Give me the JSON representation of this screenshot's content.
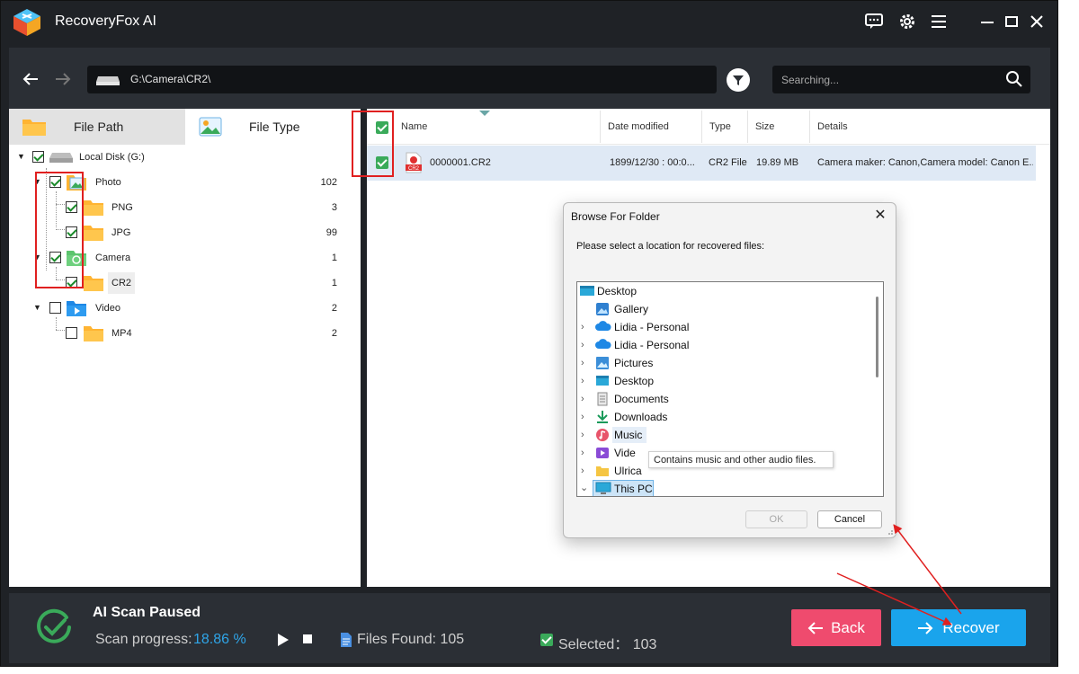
{
  "app": {
    "title": "RecoveryFox AI"
  },
  "navbar": {
    "path": "G:\\Camera\\CR2\\",
    "search_placeholder": "Searching..."
  },
  "left_panel": {
    "tabs": [
      {
        "label": "File Path"
      },
      {
        "label": "File Type"
      }
    ],
    "tree": {
      "root": {
        "label": "Local Disk (G:)",
        "checked": true
      },
      "items": [
        {
          "label": "Photo",
          "count": "102",
          "checked": true
        },
        {
          "label": "PNG",
          "count": "3",
          "checked": true
        },
        {
          "label": "JPG",
          "count": "99",
          "checked": true
        },
        {
          "label": "Camera",
          "count": "1",
          "checked": true
        },
        {
          "label": "CR2",
          "count": "1",
          "checked": true
        },
        {
          "label": "Video",
          "count": "2",
          "checked": false
        },
        {
          "label": "MP4",
          "count": "2",
          "checked": false
        }
      ]
    }
  },
  "file_table": {
    "columns": [
      "Name",
      "Date modified",
      "Type",
      "Size",
      "Details"
    ],
    "rows": [
      {
        "name": "0000001.CR2",
        "date": "1899/12/30 : 00:0...",
        "type": "CR2 File",
        "size": "19.89 MB",
        "details": "Camera maker: Canon,Camera model: Canon E..."
      }
    ],
    "file_icon_badge": "CR2"
  },
  "dialog": {
    "title": "Browse For Folder",
    "message": "Please select a location for recovered files:",
    "folders": [
      {
        "label": "Desktop",
        "icon": "desktop-icon",
        "expand": ""
      },
      {
        "label": "Gallery",
        "icon": "gallery-icon",
        "expand": ""
      },
      {
        "label": "Lidia - Personal",
        "icon": "cloud-icon",
        "expand": ">"
      },
      {
        "label": "Lidia - Personal",
        "icon": "cloud-icon",
        "expand": ">"
      },
      {
        "label": "Pictures",
        "icon": "pictures-icon",
        "expand": ">"
      },
      {
        "label": "Desktop",
        "icon": "desktop-icon",
        "expand": ">"
      },
      {
        "label": "Documents",
        "icon": "documents-icon",
        "expand": ">"
      },
      {
        "label": "Downloads",
        "icon": "downloads-icon",
        "expand": ">"
      },
      {
        "label": "Music",
        "icon": "music-icon",
        "expand": ">"
      },
      {
        "label": "Vide",
        "icon": "videos-icon",
        "expand": ">"
      },
      {
        "label": "Ulrica",
        "icon": "folder-icon",
        "expand": ">"
      },
      {
        "label": "This PC",
        "icon": "pc-icon",
        "expand": "v"
      }
    ],
    "tooltip": "Contains music and other audio files.",
    "ok_label": "OK",
    "cancel_label": "Cancel"
  },
  "bottom": {
    "status_title": "AI Scan Paused",
    "progress_label": "Scan progress:",
    "progress_value": "18.86 %",
    "progress_percent": 18.86,
    "files_found": "Files Found: 105",
    "selected": "Selected： 103",
    "back_label": "Back",
    "recover_label": "Recover"
  },
  "colors": {
    "accent_blue": "#1aa4ec",
    "back_pink": "#ef4b6e",
    "check_green": "#3aaa5a",
    "annotation_red": "#e02020"
  }
}
